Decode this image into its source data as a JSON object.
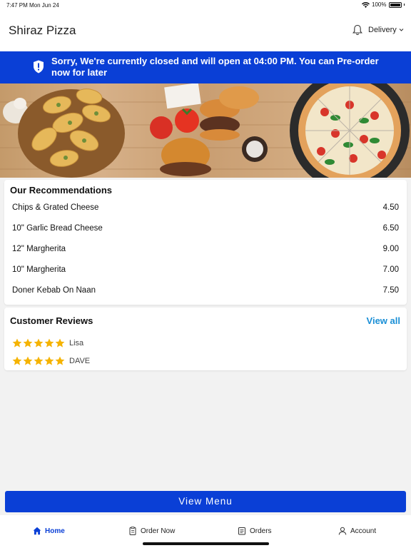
{
  "status_bar": {
    "time": "7:47 PM",
    "date": "Mon Jun 24",
    "battery": "100%"
  },
  "header": {
    "title": "Shiraz Pizza",
    "mode": "Delivery"
  },
  "banner": {
    "message": "Sorry, We're currently closed and will open at 04:00 PM. You can Pre-order now for later"
  },
  "recommendations": {
    "title": "Our Recommendations",
    "items": [
      {
        "name": "Chips & Grated Cheese",
        "price": "4.50"
      },
      {
        "name": "10\" Garlic Bread Cheese",
        "price": "6.50"
      },
      {
        "name": "12\" Margherita",
        "price": "9.00"
      },
      {
        "name": "10\" Margherita",
        "price": "7.00"
      },
      {
        "name": "Doner Kebab On Naan",
        "price": "7.50"
      }
    ]
  },
  "reviews": {
    "title": "Customer Reviews",
    "view_all": "View all",
    "items": [
      {
        "name": "Lisa",
        "rating": 5
      },
      {
        "name": "DAVE",
        "rating": 5
      }
    ]
  },
  "view_menu_label": "View Menu",
  "tabs": [
    {
      "label": "Home",
      "icon": "home-icon",
      "active": true
    },
    {
      "label": "Order Now",
      "icon": "clipboard-icon",
      "active": false
    },
    {
      "label": "Orders",
      "icon": "receipt-icon",
      "active": false
    },
    {
      "label": "Account",
      "icon": "person-icon",
      "active": false
    }
  ],
  "colors": {
    "brand_blue": "#0a3fd6",
    "link_blue": "#1a8fd6",
    "star_gold": "#f5b301"
  }
}
